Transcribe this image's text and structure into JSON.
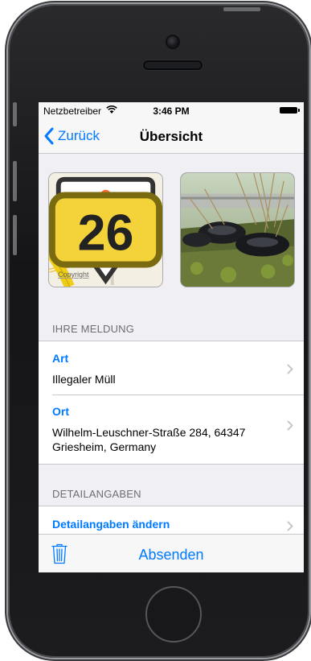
{
  "status": {
    "carrier": "Netzbetreiber",
    "time": "3:46 PM"
  },
  "nav": {
    "back_label": "Zurück",
    "title": "Übersicht"
  },
  "map": {
    "credit": "Copyright",
    "road_number": "26"
  },
  "sections": {
    "report_header": "IHRE MELDUNG",
    "details_header": "DETAILANGABEN"
  },
  "report": {
    "type_label": "Art",
    "type_value": "Illegaler Müll",
    "location_label": "Ort",
    "location_value": "Wilhelm-Leuschner-Straße 284, 64347 Griesheim, Germany"
  },
  "details": {
    "edit_label": "Detailangaben ändern"
  },
  "toolbar": {
    "send_label": "Absenden"
  },
  "icons": {
    "back": "chevron-left-icon",
    "disclosure": "chevron-right-icon",
    "trash": "trash-icon",
    "map_pin": "map-marker-icon",
    "wifi": "wifi-icon",
    "battery": "battery-icon"
  },
  "colors": {
    "tint": "#007aff",
    "background": "#efeff4",
    "marker": "#ff6a2b"
  }
}
